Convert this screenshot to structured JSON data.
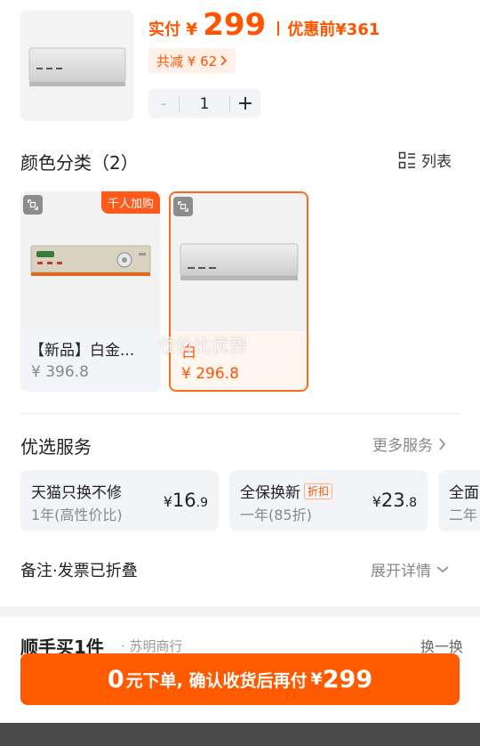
{
  "product": {
    "actual_price_label": "实付",
    "currency": "¥",
    "actual_price": "299",
    "pre_discount_label": "优惠前",
    "pre_discount_price": "¥361",
    "discount_text": "共减 ¥ 62",
    "quantity": "1",
    "minus": "-",
    "plus": "+"
  },
  "colors": {
    "title": "颜色分类（2）",
    "list_toggle_label": "列表",
    "variants": [
      {
        "name": "【新品】白金...",
        "price": "¥ 396.8",
        "tag": "千人加购"
      },
      {
        "name": "白",
        "price": "¥ 296.8"
      }
    ]
  },
  "watermark": "性价比优势",
  "services": {
    "title": "优选服务",
    "more_label": "更多服务",
    "items": [
      {
        "title": "天猫只换不修",
        "subtitle": "1年(高性价比)",
        "price_yen": "¥",
        "price_int": "16",
        "price_dec": ".9"
      },
      {
        "title": "全保换新",
        "badge": "折扣",
        "subtitle": "一年(85折)",
        "price_yen": "¥",
        "price_int": "23",
        "price_dec": ".8"
      },
      {
        "title": "全面",
        "subtitle": "二年"
      }
    ]
  },
  "note": {
    "label": "备注·发票已折叠",
    "expand_label": "展开详情"
  },
  "peek": {
    "title": "顺手买1件",
    "subtitle": "· 苏明商行",
    "right": "换一换"
  },
  "cta": {
    "zero": "0",
    "text": "元下单, 确认收货后再付",
    "yen": "¥",
    "amount": "299"
  },
  "theme": {
    "accent": "#ff5500",
    "cta": "#ff5a00"
  }
}
